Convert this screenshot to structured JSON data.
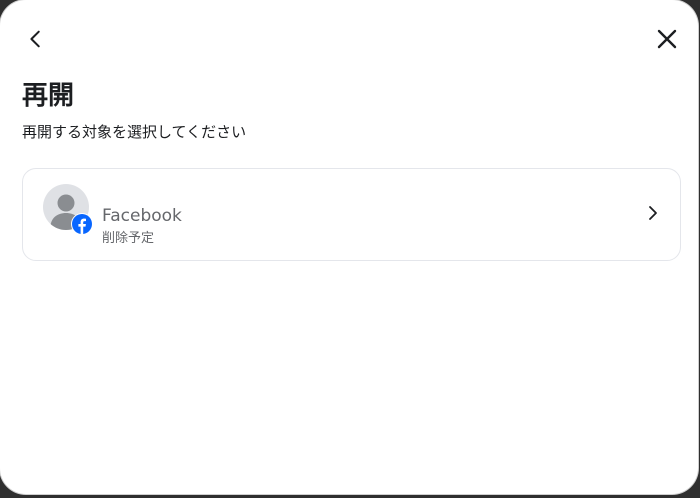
{
  "header": {
    "back_icon": "chevron-left-icon",
    "close_icon": "close-icon"
  },
  "title": "再開",
  "subtitle": "再開する対象を選択してください",
  "accounts": [
    {
      "name": "Facebook",
      "status": "削除予定",
      "avatar_icon": "default-avatar-icon",
      "badge_icon": "facebook-logo-icon",
      "chevron_icon": "chevron-right-icon"
    }
  ],
  "colors": {
    "facebook_blue": "#0866ff",
    "text_primary": "#1c1e21",
    "text_secondary": "#65676b",
    "avatar_bg": "#dfe1e5",
    "avatar_fg": "#8a8d91",
    "card_border": "#e4e6eb"
  }
}
